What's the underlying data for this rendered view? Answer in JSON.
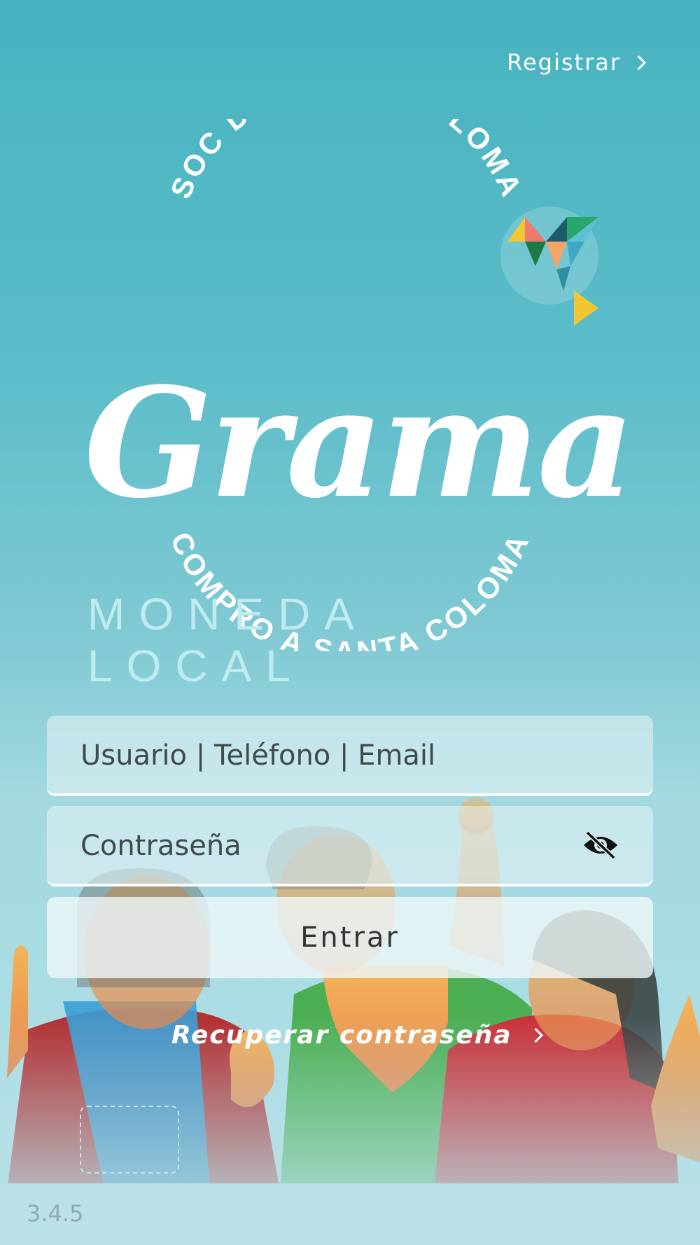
{
  "header": {
    "register_label": "Registrar"
  },
  "logo": {
    "arc_top": "SOC DE SANTA COLOMA",
    "script": "Grama",
    "subtitle": "MONEDA LOCAL",
    "arc_bottom": "COMPRO A SANTA COLOMA"
  },
  "form": {
    "user_placeholder": "Usuario | Teléfono | Email",
    "password_placeholder": "Contraseña",
    "login_label": "Entrar",
    "recover_label": "Recuperar contraseña"
  },
  "footer": {
    "version": "3.4.5"
  },
  "colors": {
    "background_top": "#47b3c0",
    "background_bottom": "#b4e0e6",
    "field_bg": "#e1f0f3",
    "button_bg": "#eef6f8"
  },
  "icons": {
    "register_chevron": "chevron-right-icon",
    "password_toggle": "eye-slash-icon",
    "recover_chevron": "chevron-right-icon",
    "logo_bird": "origami-bird-icon"
  }
}
